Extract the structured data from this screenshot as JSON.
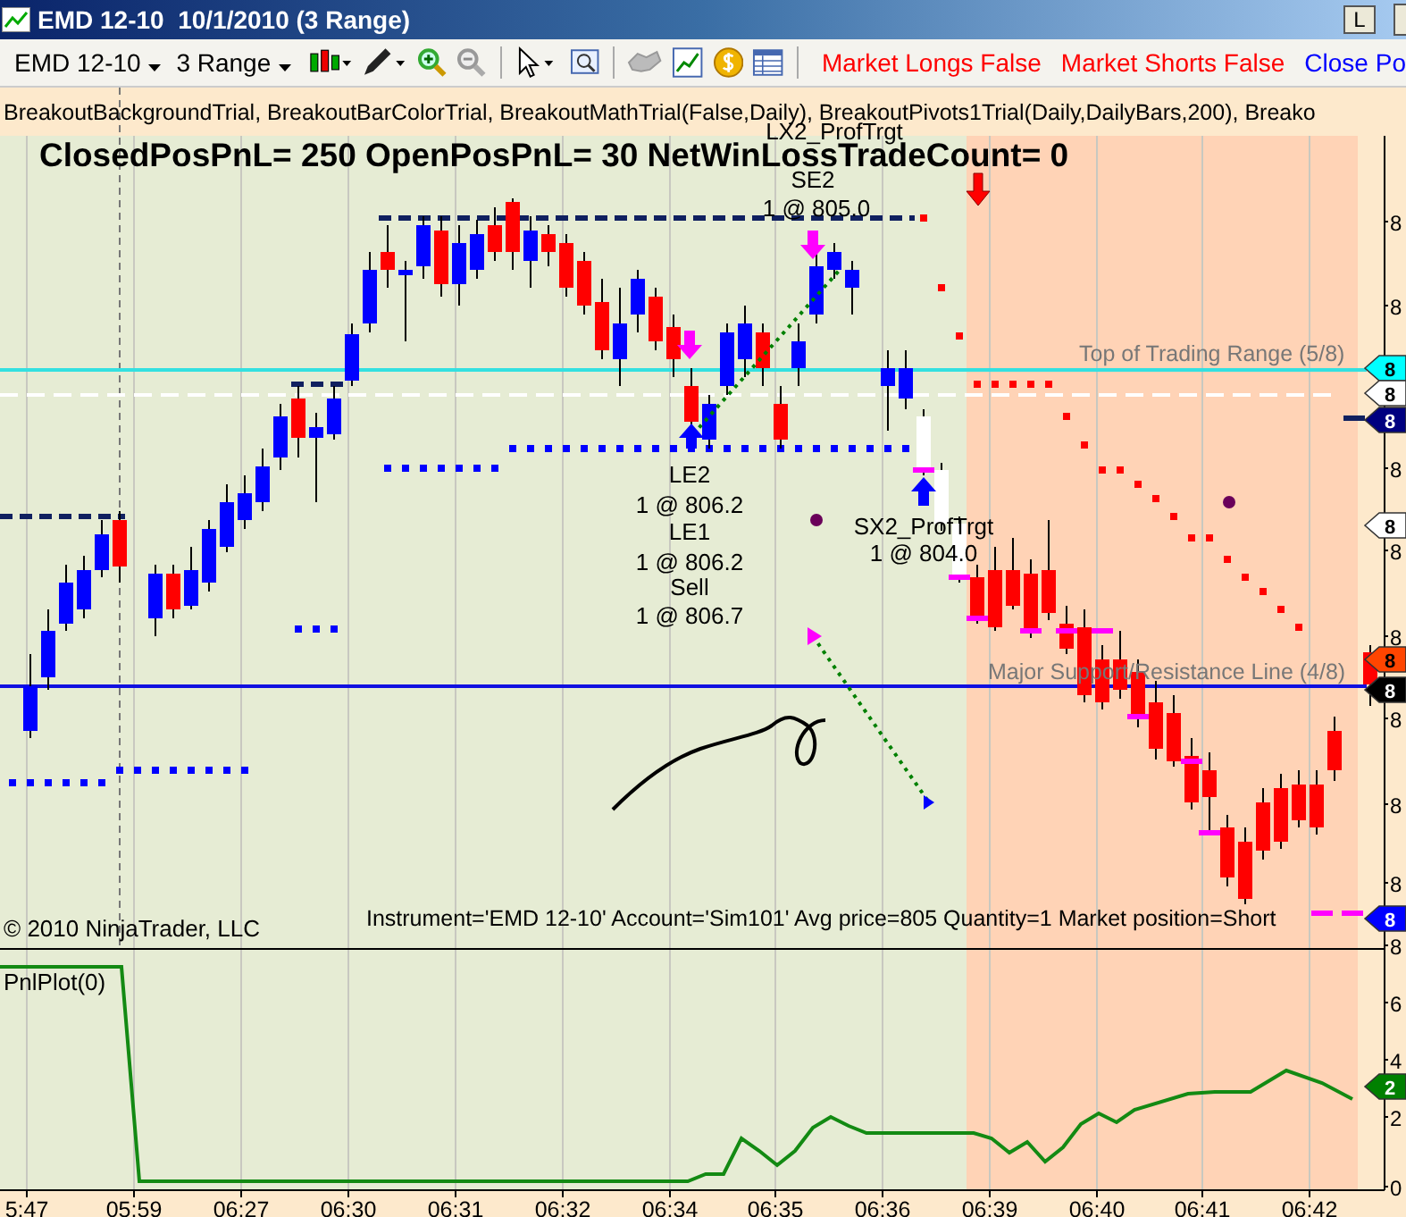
{
  "window": {
    "title": "EMD 12-10  10/1/2010 (3 Range)",
    "buttons": [
      "L"
    ]
  },
  "toolbar": {
    "instrument": "EMD 12-10",
    "period": "3 Range",
    "status": [
      {
        "text": "Market Longs False",
        "color": "#ff0000"
      },
      {
        "text": "Market Shorts False",
        "color": "#ff0000"
      },
      {
        "text": "Close Po",
        "color": "#0000ff"
      }
    ]
  },
  "chart": {
    "indicators": "BreakoutBackgroundTrial,  BreakoutBarColorTrial,  BreakoutMathTrial(False,Daily),  BreakoutPivots1Trial(Daily,DailyBars,200),  Breako",
    "stats": "ClosedPosPnL= 250  OpenPosPnL= 30  NetWinLossTradeCount= 0",
    "trade_labels": [
      "LX2_ProfTrgt",
      "SE2",
      "1 @ 805.0",
      "LE2",
      "1 @ 806.2",
      "LE1",
      "1 @ 806.2",
      "Sell",
      "1 @ 806.7",
      "SX2_ProfTrgt",
      "1 @ 804.0"
    ],
    "line_labels": [
      "Top of Trading Range (5/8)",
      "Major Support/Resistance Line (4/8)"
    ],
    "copyright": "© 2010 NinjaTrader, LLC",
    "position_info": "Instrument='EMD 12-10' Account='Sim101' Avg price=805 Quantity=1 Market position=Short",
    "price_axis": [
      "8",
      "8",
      "8",
      "8",
      "8",
      "8",
      "8",
      "8"
    ],
    "price_markers": [
      {
        "text": "8",
        "color": "#00ffff"
      },
      {
        "text": "8",
        "color": "#ffffff"
      },
      {
        "text": "8",
        "color": "#000080"
      },
      {
        "text": "8",
        "color": "#ffffff"
      },
      {
        "text": "8",
        "color": "#ff4500"
      },
      {
        "text": "8",
        "color": "#000000"
      },
      {
        "text": "8",
        "color": "#0000ff"
      }
    ],
    "lower_pane": {
      "title": "PnlPlot(0)",
      "axis": [
        "8",
        "6",
        "4",
        "2",
        "0"
      ],
      "markers": [
        {
          "text": "2",
          "color": "#008000"
        }
      ]
    },
    "time_axis": [
      "5:47",
      "05:59",
      "06:27",
      "06:30",
      "06:31",
      "06:32",
      "06:34",
      "06:35",
      "06:36",
      "06:39",
      "06:40",
      "06:41",
      "06:42"
    ]
  }
}
